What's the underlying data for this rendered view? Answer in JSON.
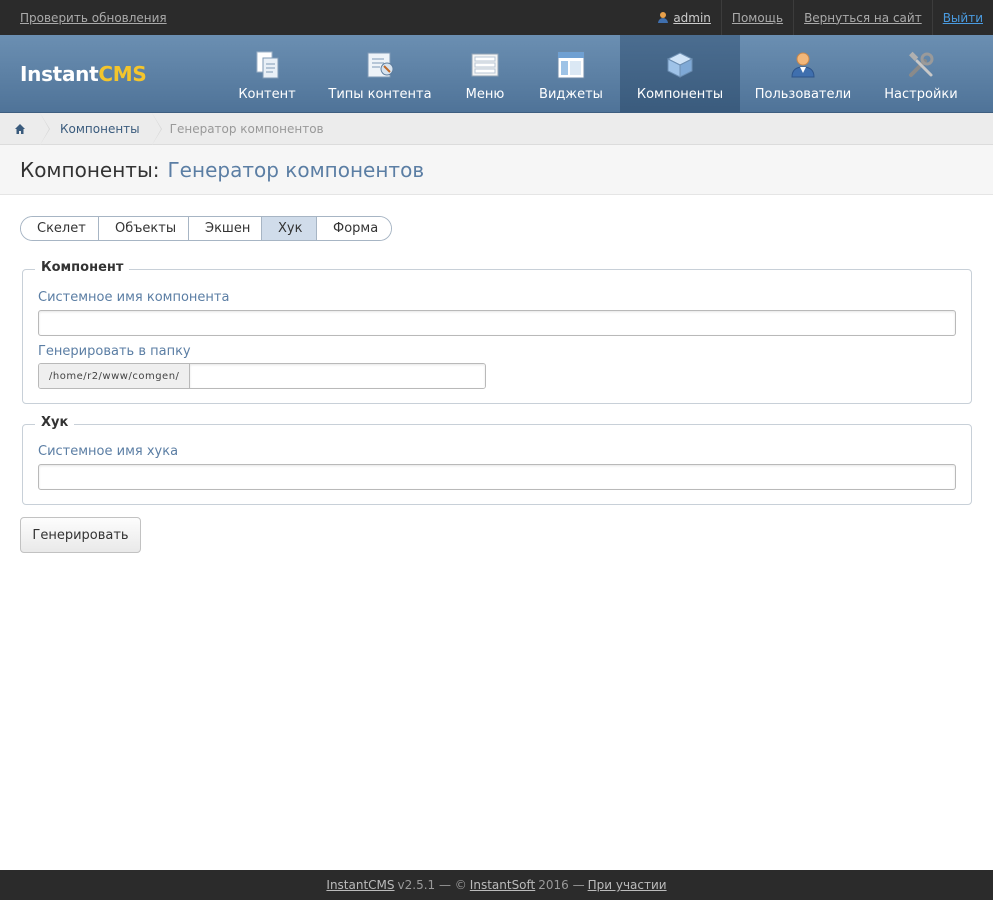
{
  "topbar": {
    "check_updates": "Проверить обновления",
    "user": "admin",
    "help": "Помощь",
    "back_to_site": "Вернуться на сайт",
    "logout": "Выйти"
  },
  "logo": {
    "part1": "Instant",
    "part2": "CMS"
  },
  "nav": {
    "items": [
      {
        "label": "Контент",
        "icon": "content-icon"
      },
      {
        "label": "Типы контента",
        "icon": "content-types-icon"
      },
      {
        "label": "Меню",
        "icon": "menu-icon"
      },
      {
        "label": "Виджеты",
        "icon": "widgets-icon"
      },
      {
        "label": "Компоненты",
        "icon": "components-icon",
        "active": true
      },
      {
        "label": "Пользователи",
        "icon": "users-icon"
      },
      {
        "label": "Настройки",
        "icon": "settings-icon"
      }
    ]
  },
  "breadcrumb": {
    "home_icon": "home-icon",
    "link": "Компоненты",
    "current": "Генератор компонентов"
  },
  "page_title": {
    "main": "Компоненты:",
    "sub": "Генератор компонентов"
  },
  "tabs": [
    {
      "label": "Скелет"
    },
    {
      "label": "Объекты"
    },
    {
      "label": "Экшен"
    },
    {
      "label": "Хук",
      "active": true
    },
    {
      "label": "Форма"
    }
  ],
  "fieldset_component": {
    "legend": "Компонент",
    "system_name_label": "Системное имя компонента",
    "system_name_value": "",
    "folder_label": "Генерировать в папку",
    "folder_prefix": "/home/r2/www/comgen/",
    "folder_value": ""
  },
  "fieldset_hook": {
    "legend": "Хук",
    "hook_name_label": "Системное имя хука",
    "hook_name_value": ""
  },
  "generate_button": "Генерировать",
  "footer": {
    "product": "InstantCMS",
    "version": "v2.5.1 — ©",
    "company": "InstantSoft",
    "year": "2016 —",
    "participation": "При участии"
  }
}
